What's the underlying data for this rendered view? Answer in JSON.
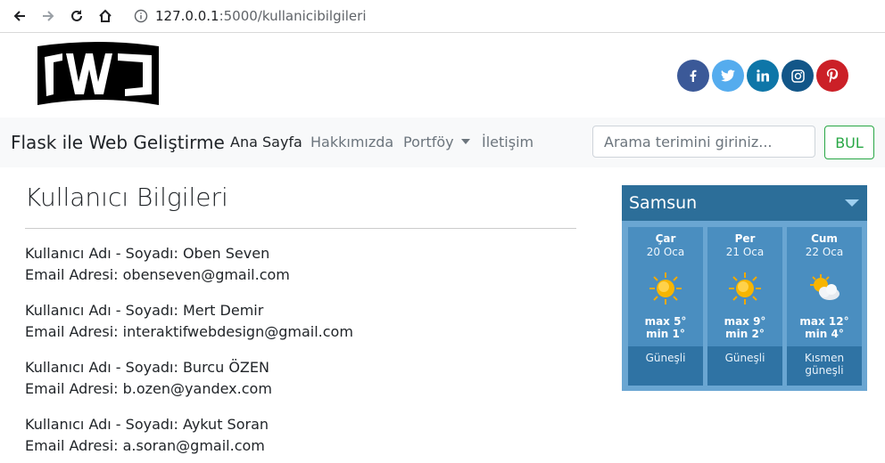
{
  "browser": {
    "url_host": "127.0.0.1",
    "url_path": ":5000/kullanicibilgileri"
  },
  "header": {
    "logo_text": "FWJ",
    "social": [
      {
        "name": "facebook",
        "glyph": "f",
        "color": "#3b5998"
      },
      {
        "name": "twitter",
        "glyph": "t",
        "color": "#55acee"
      },
      {
        "name": "linkedin",
        "glyph": "in",
        "color": "#0e76a8"
      },
      {
        "name": "instagram",
        "glyph": "ig",
        "color": "#125688"
      },
      {
        "name": "pinterest",
        "glyph": "p",
        "color": "#cb2027"
      }
    ]
  },
  "navbar": {
    "brand": "Flask ile Web Geliştirme",
    "links": [
      {
        "label": "Ana Sayfa",
        "active": true
      },
      {
        "label": "Hakkımızda",
        "active": false
      },
      {
        "label": "Portföy",
        "active": false,
        "dropdown": true
      },
      {
        "label": "İletişim",
        "active": false
      }
    ],
    "search_placeholder": "Arama terimini giriniz...",
    "search_button": "BUL"
  },
  "main": {
    "title": "Kullanıcı Bilgileri",
    "users": [
      {
        "name_line": "Kullanıcı Adı - Soyadı: Oben Seven",
        "email_line": "Email Adresi: obenseven@gmail.com"
      },
      {
        "name_line": "Kullanıcı Adı - Soyadı: Mert Demir",
        "email_line": "Email Adresi: interaktifwebdesign@gmail.com"
      },
      {
        "name_line": "Kullanıcı Adı - Soyadı: Burcu ÖZEN",
        "email_line": "Email Adresi: b.ozen@yandex.com"
      },
      {
        "name_line": "Kullanıcı Adı - Soyadı: Aykut Soran",
        "email_line": "Email Adresi: a.soran@gmail.com"
      }
    ]
  },
  "weather": {
    "city": "Samsun",
    "days": [
      {
        "day": "Çar",
        "date": "20 Oca",
        "max": "max 5°",
        "min": "min 1°",
        "desc": "Güneşli",
        "icon": "sun-icon"
      },
      {
        "day": "Per",
        "date": "21 Oca",
        "max": "max 9°",
        "min": "min 2°",
        "desc": "Güneşli",
        "icon": "sun-icon"
      },
      {
        "day": "Cum",
        "date": "22 Oca",
        "max": "max 12°",
        "min": "min 4°",
        "desc": "Kısmen güneşli",
        "icon": "partly-cloudy-icon"
      }
    ]
  }
}
